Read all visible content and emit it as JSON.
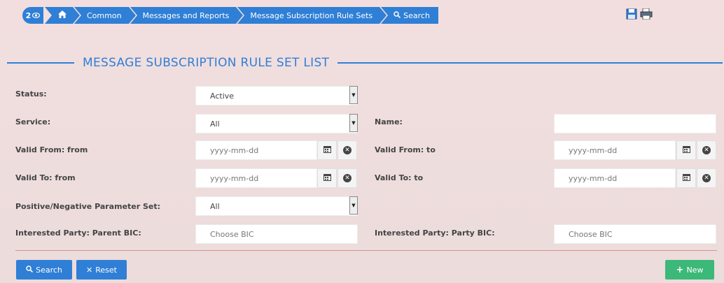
{
  "breadcrumb": {
    "badge_count": "2",
    "items": [
      "Common",
      "Messages and Reports",
      "Message Subscription Rule Sets",
      "Search"
    ]
  },
  "title": "MESSAGE SUBSCRIPTION RULE SET LIST",
  "form": {
    "status": {
      "label": "Status:",
      "value": "Active"
    },
    "service": {
      "label": "Service:",
      "value": "All"
    },
    "name": {
      "label": "Name:",
      "value": ""
    },
    "valid_from_from": {
      "label": "Valid From: from",
      "placeholder": "yyyy-mm-dd"
    },
    "valid_from_to": {
      "label": "Valid From: to",
      "placeholder": "yyyy-mm-dd"
    },
    "valid_to_from": {
      "label": "Valid To: from",
      "placeholder": "yyyy-mm-dd"
    },
    "valid_to_to": {
      "label": "Valid To: to",
      "placeholder": "yyyy-mm-dd"
    },
    "pos_neg": {
      "label": "Positive/Negative Parameter Set:",
      "value": "All"
    },
    "parent_bic": {
      "label": "Interested Party: Parent BIC:",
      "placeholder": "Choose BIC"
    },
    "party_bic": {
      "label": "Interested Party: Party BIC:",
      "placeholder": "Choose BIC"
    }
  },
  "buttons": {
    "search": "Search",
    "reset": "Reset",
    "new": "New"
  },
  "colors": {
    "accent": "#2f7fd6",
    "new_button": "#3cb878",
    "background": "#f2dede"
  }
}
